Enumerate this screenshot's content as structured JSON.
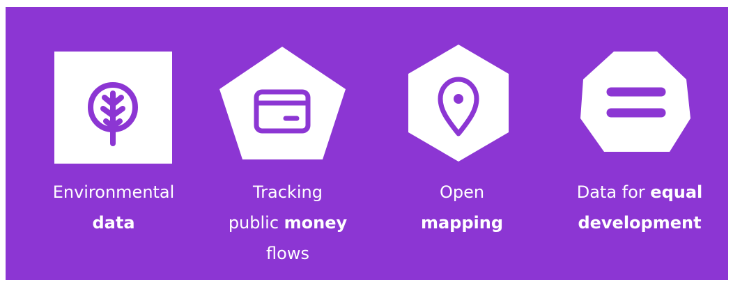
{
  "items": [
    {
      "id": "environmental",
      "icon": "leaf-icon",
      "shape": "square",
      "lines": [
        [
          {
            "text": "Environmental",
            "bold": false
          }
        ],
        [
          {
            "text": "data",
            "bold": true
          }
        ]
      ]
    },
    {
      "id": "money",
      "icon": "credit-card-icon",
      "shape": "pentagon",
      "lines": [
        [
          {
            "text": "Tracking",
            "bold": false
          }
        ],
        [
          {
            "text": "public ",
            "bold": false
          },
          {
            "text": "money",
            "bold": true
          }
        ],
        [
          {
            "text": "flows",
            "bold": false
          }
        ]
      ]
    },
    {
      "id": "mapping",
      "icon": "map-pin-icon",
      "shape": "hexagon",
      "lines": [
        [
          {
            "text": "Open",
            "bold": false
          }
        ],
        [
          {
            "text": "mapping",
            "bold": true
          }
        ]
      ]
    },
    {
      "id": "equal",
      "icon": "equals-icon",
      "shape": "octagon",
      "lines": [
        [
          {
            "text": "Data for ",
            "bold": false
          },
          {
            "text": "equal",
            "bold": true
          }
        ],
        [
          {
            "text": "development",
            "bold": true
          }
        ]
      ]
    }
  ],
  "colors": {
    "background": "#8c36d3",
    "shape_fill": "#ffffff",
    "icon_color": "#8c36d3",
    "text": "#ffffff"
  }
}
